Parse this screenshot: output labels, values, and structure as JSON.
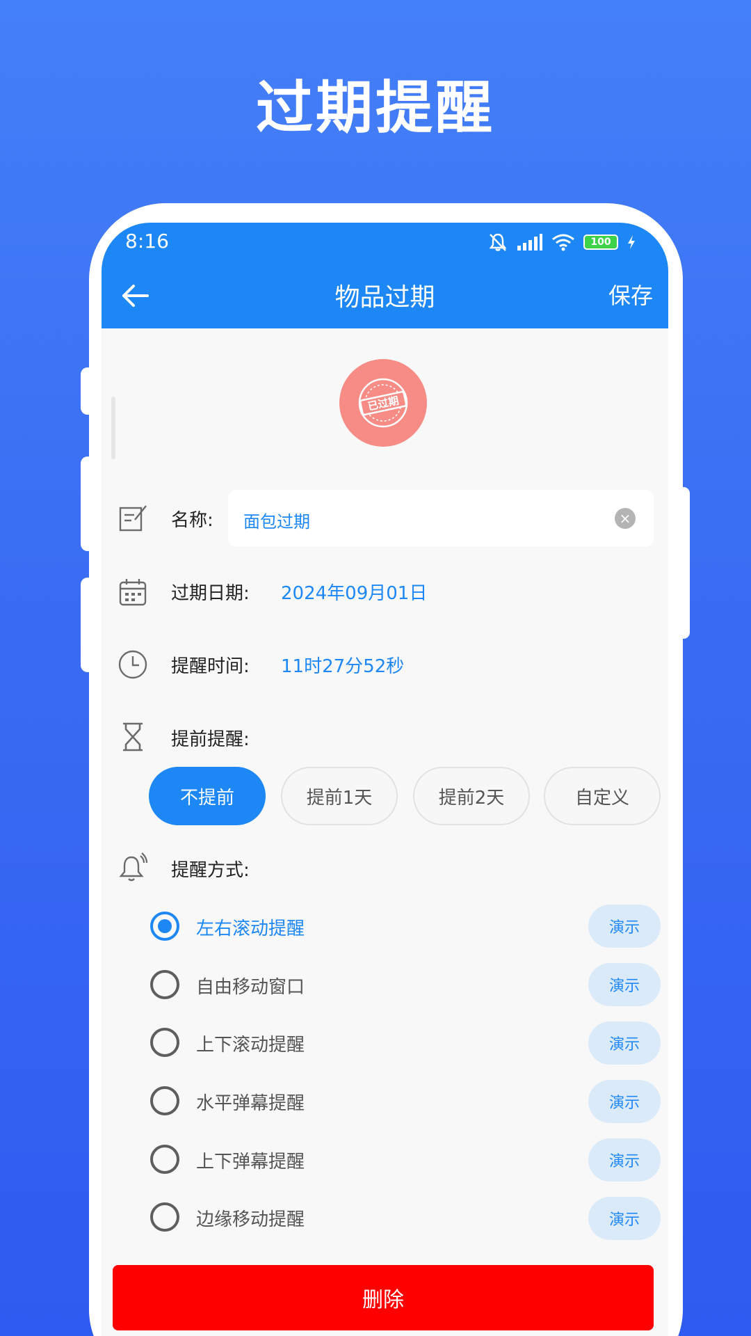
{
  "hero": {
    "title": "过期提醒"
  },
  "status_bar": {
    "time": "8:16",
    "battery": "100"
  },
  "appbar": {
    "title": "物品过期",
    "save_label": "保存"
  },
  "badge": {
    "stamp_text": "已过期"
  },
  "form": {
    "name_label": "名称:",
    "name_value": "面包过期",
    "date_label": "过期日期:",
    "date_value": "2024年09月01日",
    "time_label": "提醒时间:",
    "time_value": "11时27分52秒",
    "advance_label": "提前提醒:",
    "advance_options": [
      {
        "label": "不提前",
        "selected": true
      },
      {
        "label": "提前1天",
        "selected": false
      },
      {
        "label": "提前2天",
        "selected": false
      },
      {
        "label": "自定义",
        "selected": false
      }
    ],
    "method_label": "提醒方式:",
    "methods": [
      {
        "label": "左右滚动提醒",
        "selected": true,
        "demo": "演示"
      },
      {
        "label": "自由移动窗口",
        "selected": false,
        "demo": "演示"
      },
      {
        "label": "上下滚动提醒",
        "selected": false,
        "demo": "演示"
      },
      {
        "label": "水平弹幕提醒",
        "selected": false,
        "demo": "演示"
      },
      {
        "label": "上下弹幕提醒",
        "selected": false,
        "demo": "演示"
      },
      {
        "label": "边缘移动提醒",
        "selected": false,
        "demo": "演示"
      }
    ]
  },
  "delete_label": "删除",
  "colors": {
    "primary": "#1d88f5",
    "danger": "#ff0000",
    "background": "#4480f8",
    "badge": "#f78c86"
  }
}
